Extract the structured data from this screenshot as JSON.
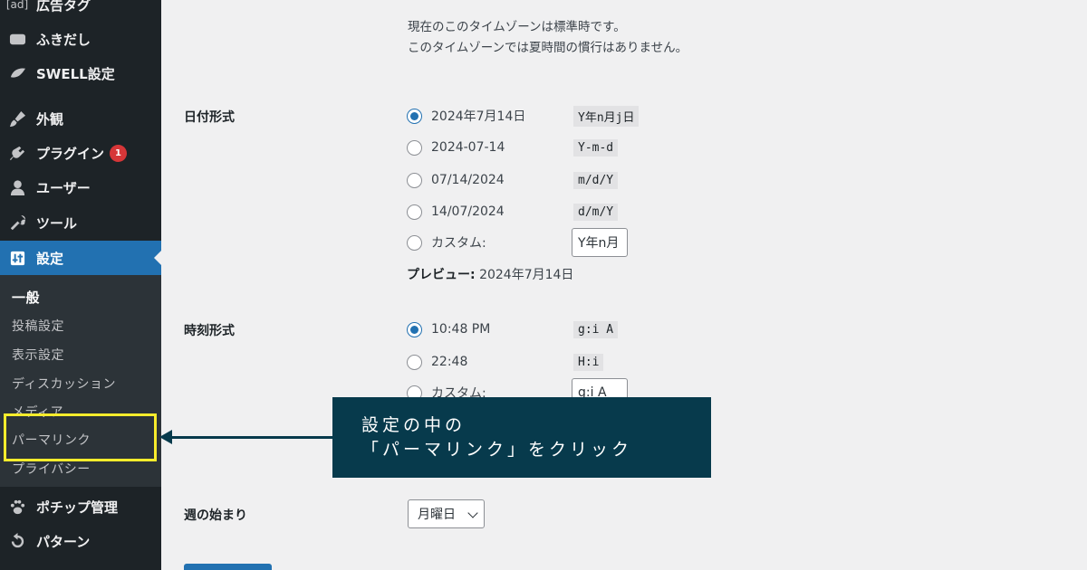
{
  "sidebar": {
    "items": [
      {
        "id": "ad",
        "prefix": "[ad]",
        "label": "広告タグ",
        "icon": "ad-tag-icon"
      },
      {
        "id": "fukidashi",
        "label": "ふきだし",
        "icon": "speech-bubble-icon"
      },
      {
        "id": "swell",
        "label": "SWELL設定",
        "icon": "swell-leaf-icon"
      },
      {
        "id": "appearance",
        "label": "外観",
        "icon": "paintbrush-icon"
      },
      {
        "id": "plugins",
        "label": "プラグイン",
        "icon": "plugin-icon",
        "badge": "1"
      },
      {
        "id": "users",
        "label": "ユーザー",
        "icon": "user-icon"
      },
      {
        "id": "tools",
        "label": "ツール",
        "icon": "wrench-icon"
      },
      {
        "id": "settings",
        "label": "設定",
        "icon": "settings-sliders-icon"
      },
      {
        "id": "pochipp",
        "label": "ポチップ管理",
        "icon": "paw-icon"
      },
      {
        "id": "patterns",
        "label": "パターン",
        "icon": "refresh-icon"
      }
    ],
    "submenu": [
      "一般",
      "投稿設定",
      "表示設定",
      "ディスカッション",
      "メディア",
      "パーマリンク",
      "プライバシー"
    ]
  },
  "timezone": {
    "note1": "現在のこのタイムゾーンは標準時です。",
    "note2": "このタイムゾーンでは夏時間の慣行はありません。"
  },
  "date_format": {
    "label": "日付形式",
    "options": [
      {
        "label": "2024年7月14日",
        "code": "Y年n月j日",
        "checked": true
      },
      {
        "label": "2024-07-14",
        "code": "Y-m-d"
      },
      {
        "label": "07/14/2024",
        "code": "m/d/Y"
      },
      {
        "label": "14/07/2024",
        "code": "d/m/Y"
      }
    ],
    "custom_label": "カスタム:",
    "custom_value": "Y年n月",
    "preview_label": "プレビュー:",
    "preview_value": "2024年7月14日"
  },
  "time_format": {
    "label": "時刻形式",
    "options": [
      {
        "label": "10:48 PM",
        "code": "g:i A",
        "checked": true
      },
      {
        "label": "22:48",
        "code": "H:i"
      }
    ],
    "custom_label": "カスタム:",
    "custom_value": "g:i A"
  },
  "week_start": {
    "label": "週の始まり",
    "value": "月曜日"
  },
  "callout": {
    "line1": "設定の中の",
    "line2": "「パーマリンク」をクリック"
  },
  "colors": {
    "sidebar_bg": "#1d2327",
    "active": "#2271b1",
    "highlight": "#f8ec2c",
    "callout_bg": "#073a4c",
    "badge": "#d63638"
  }
}
